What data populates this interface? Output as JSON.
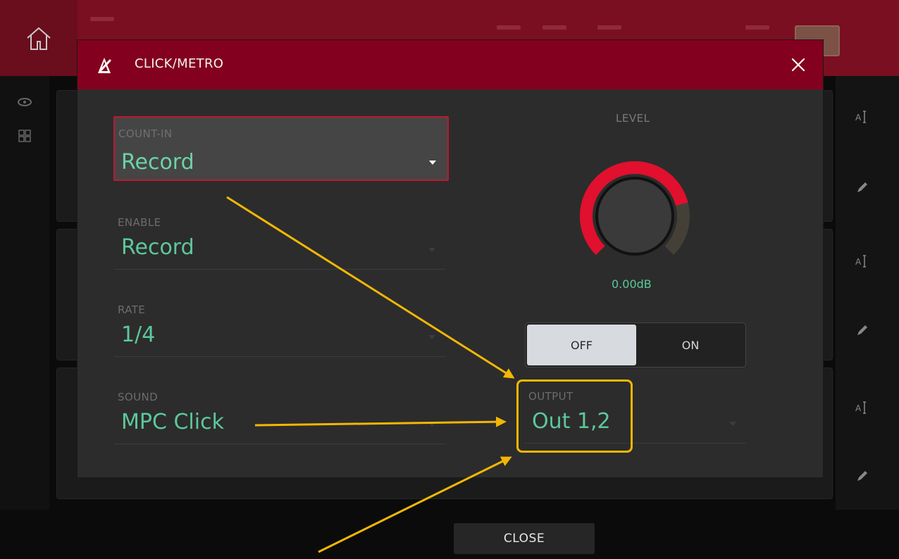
{
  "modal": {
    "title": "CLICK/METRO",
    "fields": {
      "count_in": {
        "label": "COUNT-IN",
        "value": "Record"
      },
      "enable": {
        "label": "ENABLE",
        "value": "Record"
      },
      "rate": {
        "label": "RATE",
        "value": "1/4"
      },
      "sound": {
        "label": "SOUND",
        "value": "MPC Click"
      },
      "output": {
        "label": "OUTPUT",
        "value": "Out 1,2"
      }
    },
    "level": {
      "label": "LEVEL",
      "value": "0.00dB",
      "fraction": 0.78
    },
    "toggle": {
      "off_label": "OFF",
      "on_label": "ON",
      "selected": "OFF"
    }
  },
  "footer": {
    "close_label": "CLOSE"
  },
  "colors": {
    "accent": "#83001e",
    "value_text": "#5cc89c",
    "annotation": "#f2b705",
    "knob_active": "#e0102e"
  },
  "icons": [
    "home-icon",
    "metronome-icon",
    "close-icon",
    "eye-icon",
    "grid-icon",
    "text-cursor-icon",
    "pencil-icon"
  ]
}
